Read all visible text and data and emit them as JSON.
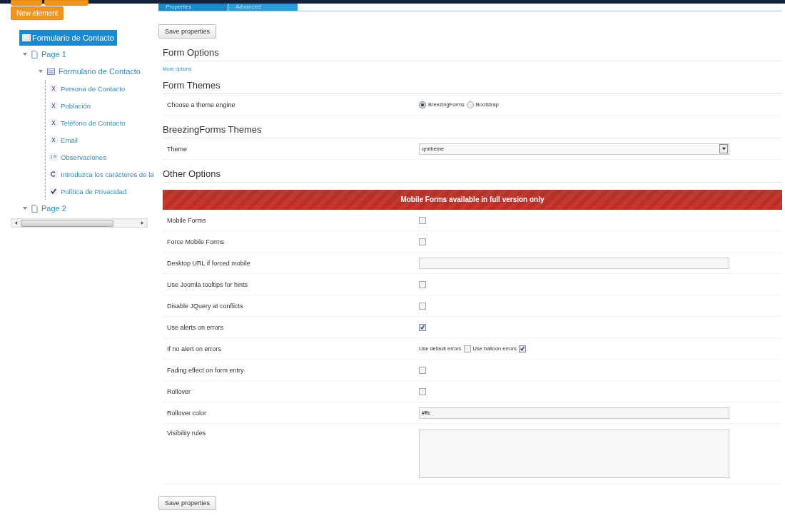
{
  "toolbar": {
    "buttons": [
      "New element"
    ]
  },
  "tree": {
    "root": {
      "label": "Formulario de Contacto",
      "selected": true
    },
    "pages": [
      {
        "label": "Page 1",
        "expanded": true,
        "children": [
          {
            "label": "Formulario de Contacto",
            "kind": "form",
            "expanded": true,
            "children": [
              {
                "label": "Persona de Contacto",
                "kind": "text"
              },
              {
                "label": "Población",
                "kind": "text"
              },
              {
                "label": "Teléfono de Contacto",
                "kind": "text"
              },
              {
                "label": "Email",
                "kind": "text"
              },
              {
                "label": "Observaciones",
                "kind": "textarea"
              },
              {
                "label": "Introduzca los carácteres de la",
                "kind": "captcha"
              },
              {
                "label": "Política de Privacidad",
                "kind": "checkbox"
              }
            ]
          }
        ]
      },
      {
        "label": "Page 2",
        "expanded": true
      }
    ]
  },
  "tabs": [
    {
      "label": "Properties",
      "selected": true
    },
    {
      "label": "Advanced",
      "selected": false
    }
  ],
  "save_button": "Save properties",
  "sections": [
    {
      "title": "Form Options",
      "link": "More options"
    },
    {
      "title": "Form Themes",
      "rows": [
        {
          "label": "Choose a theme engine",
          "kind": "radio",
          "options": [
            {
              "label": "BreezingForms",
              "selected": true
            },
            {
              "label": "Bootstrap",
              "selected": false
            }
          ]
        }
      ]
    },
    {
      "title": "BreezingForms Themes",
      "rows": [
        {
          "label": "Theme",
          "kind": "select",
          "value": "qmtheme"
        }
      ]
    },
    {
      "title": "Other Options",
      "banner": "Mobile Forms available in full version only",
      "rows": [
        {
          "label": "Mobile Forms",
          "kind": "checkbox",
          "checked": false
        },
        {
          "label": "Force Mobile Forms",
          "kind": "checkbox",
          "checked": false
        },
        {
          "label": "Desktop URL if forced mobile",
          "kind": "text",
          "value": ""
        },
        {
          "label": "Use Joomla tooltips for hints",
          "kind": "checkbox",
          "checked": false
        },
        {
          "label": "Disable JQuery at conflicts",
          "kind": "checkbox",
          "checked": false
        },
        {
          "label": "Use alerts on errors",
          "kind": "checkbox",
          "checked": true
        },
        {
          "label": "If no alert on errors",
          "kind": "checks",
          "options": [
            {
              "label": "Use default errors",
              "checked": false
            },
            {
              "label": "Use balloon errors",
              "checked": true
            }
          ]
        },
        {
          "label": "Fading effect on form entry",
          "kind": "checkbox",
          "checked": false
        },
        {
          "label": "Rollover",
          "kind": "checkbox",
          "checked": false
        },
        {
          "label": "Rollover color",
          "kind": "text",
          "value": "#ffc"
        },
        {
          "label": "Visibility rules",
          "kind": "textarea",
          "value": ""
        }
      ]
    }
  ],
  "bottom_save_button": "Save properties"
}
